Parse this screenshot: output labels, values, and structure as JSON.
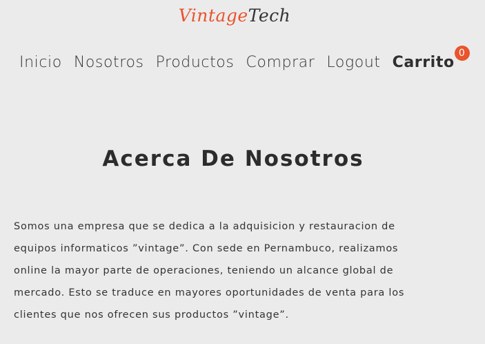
{
  "logo": {
    "part1": "Vintage",
    "part2": "Tech"
  },
  "nav": {
    "items": [
      "Inicio",
      "Nosotros",
      "Productos",
      "Comprar",
      "Logout"
    ],
    "cart_label": "Carrito",
    "cart_count": "0"
  },
  "main": {
    "title": "Acerca De Nosotros",
    "paragraph": "Somos una empresa que se dedica a la adquisicion y restauracion de equipos informaticos ”vintage”. Con sede en Pernambuco, realizamos online la mayor parte de operaciones, teniendo un alcance global de mercado. Esto se traduce en mayores oportunidades de venta para los clientes que nos ofrecen sus productos ”vintage”."
  },
  "colors": {
    "accent": "#e8542c",
    "background": "#ebebeb",
    "text": "#333333"
  }
}
